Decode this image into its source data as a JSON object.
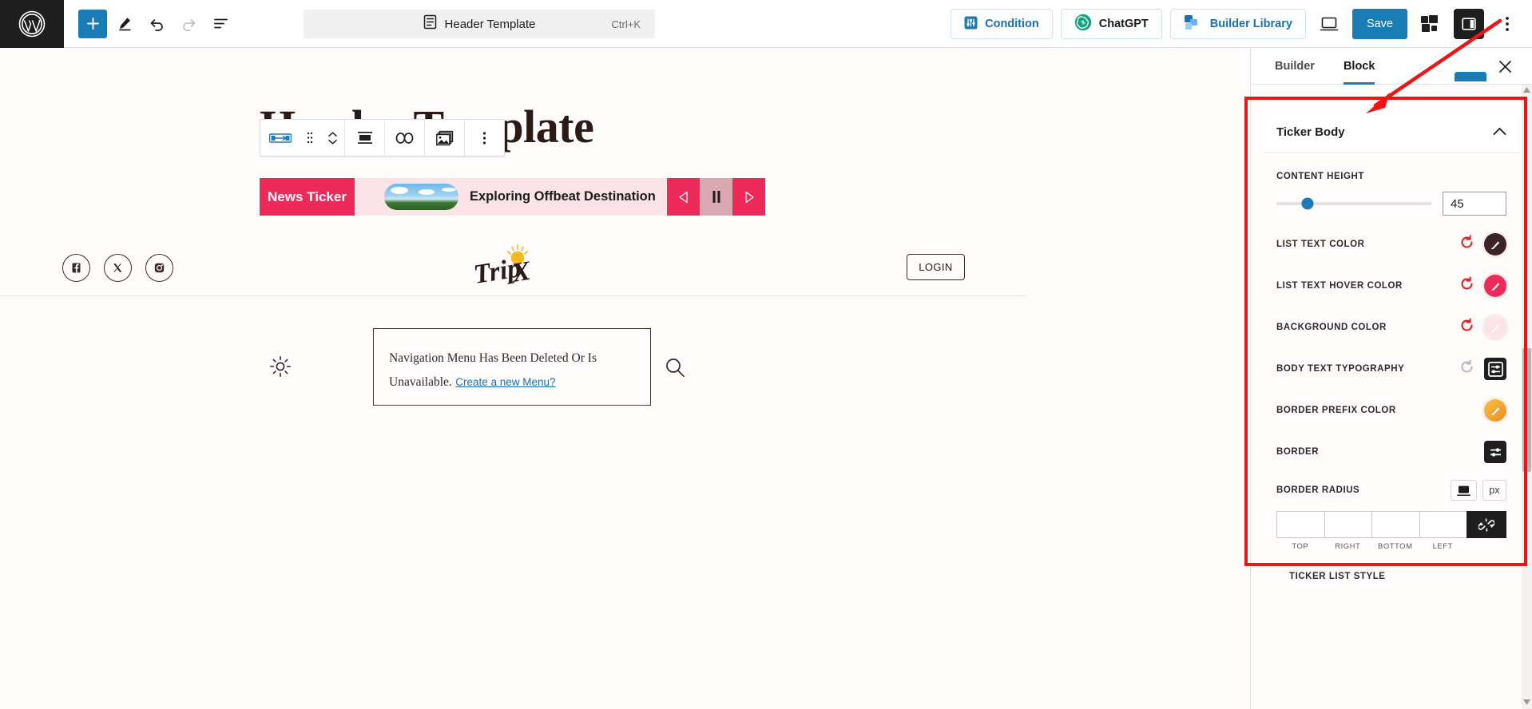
{
  "topbar": {
    "logo": "wordpress-logo",
    "tools": [
      {
        "name": "add-block-button",
        "icon": "plus-icon"
      },
      {
        "name": "edit-tool-button",
        "icon": "pencil-icon"
      },
      {
        "name": "undo-button",
        "icon": "undo-arrow-icon"
      },
      {
        "name": "redo-button",
        "icon": "redo-arrow-icon"
      },
      {
        "name": "document-overview-button",
        "icon": "list-view-icon"
      }
    ],
    "document": {
      "title": "Header Template",
      "shortcut": "Ctrl+K",
      "icon": "document-icon"
    },
    "condition_label": "Condition",
    "chatgpt_label": "ChatGPT",
    "library_label": "Builder Library",
    "save_label": "Save",
    "view_icon": "desktop-view-icon",
    "layers_icon": "layers-icon",
    "sidebar_toggle_icon": "sidebar-panel-icon",
    "options_icon": "three-dot-vertical-icon",
    "accent_blue": "#1a7cb5"
  },
  "canvas": {
    "heading": "Header Template",
    "block_toolbar": {
      "icons": [
        "block-type-icon",
        "drag-handle-icon",
        "move-updown-icon",
        "align-icon",
        "link-icon",
        "image-icon",
        "more-options-icon"
      ]
    },
    "ticker": {
      "label": "News Ticker",
      "headline": "Exploring Offbeat Destination",
      "thumbnail": "landscape-thumbnail",
      "prev_icon": "triangle-left-icon",
      "pause_icon": "pause-icon",
      "next_icon": "triangle-right-icon",
      "accent": "#ee2a5b",
      "body_bg": "#fbe3e8"
    },
    "socials": [
      {
        "name": "facebook-icon",
        "label": "Facebook"
      },
      {
        "name": "x-twitter-icon",
        "label": "X"
      },
      {
        "name": "instagram-icon",
        "label": "Instagram"
      }
    ],
    "brand": {
      "name": "tripx-logo",
      "text": "TripX"
    },
    "login_label": "LOGIN",
    "brightness_icon": "sun-brightness-icon",
    "search_icon": "search-magnifier-icon",
    "notice": {
      "text": "Navigation Menu Has Been Deleted Or Is Unavailable.",
      "link": "Create a new Menu?"
    }
  },
  "sidebar": {
    "tabs": [
      {
        "label": "Builder",
        "active": false
      },
      {
        "label": "Block",
        "active": true
      }
    ],
    "close_icon": "close-x-icon",
    "accordion": {
      "title": "Ticker Body",
      "chevron": "chevron-up-icon"
    },
    "content_height": {
      "label": "Content Height",
      "value": "45",
      "slider_percent": 20
    },
    "controls": [
      {
        "label": "LIST TEXT COLOR",
        "name": "list-text-color",
        "reset": true,
        "swatch": "#3b2326",
        "type": "color"
      },
      {
        "label": "LIST TEXT HOVER COLOR",
        "name": "list-text-hover-color",
        "reset": true,
        "swatch": "#ee2a5b",
        "type": "color"
      },
      {
        "label": "BACKGROUND COLOR",
        "name": "background-color",
        "reset": true,
        "swatch": "#fbe3e8",
        "type": "color"
      },
      {
        "label": "BODY TEXT TYPOGRAPHY",
        "name": "body-text-typography",
        "reset": true,
        "reset_disabled": true,
        "type": "settings"
      },
      {
        "label": "BORDER PREFIX COLOR",
        "name": "border-prefix-color",
        "reset": false,
        "swatch": "#f0a830",
        "type": "color"
      },
      {
        "label": "BORDER",
        "name": "border",
        "reset": false,
        "type": "settings"
      }
    ],
    "border_radius": {
      "label": "BORDER RADIUS",
      "device_icon": "desktop-device-icon",
      "unit": "px",
      "values": [
        "",
        "",
        "",
        ""
      ],
      "sides": [
        "TOP",
        "RIGHT",
        "BOTTOM",
        "LEFT"
      ],
      "link_icon": "unlink-icon"
    },
    "next_section_label": "TICKER LIST STYLE",
    "highlight_color": "#f01414"
  }
}
